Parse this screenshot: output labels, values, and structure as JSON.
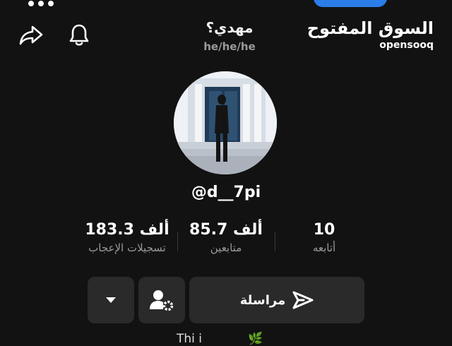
{
  "header": {
    "title": "مهدي؟",
    "pronouns": "he/he/he",
    "logo_ar": "السوق المفتوح",
    "logo_en": "opensooq"
  },
  "profile": {
    "username": "@d__7pi"
  },
  "stats": [
    {
      "value": "183.3 ألف",
      "label": "تسجيلات الإعجاب"
    },
    {
      "value": "85.7 ألف",
      "label": "متابعين"
    },
    {
      "value": "10",
      "label": "أتابعه"
    }
  ],
  "actions": {
    "message_label": "مراسلة"
  },
  "bio": {
    "text": "Thi i"
  },
  "colors": {
    "background": "#121212",
    "button": "#2a2a2a",
    "muted_text": "#9a9a9a",
    "accent": "#2b7de9"
  }
}
